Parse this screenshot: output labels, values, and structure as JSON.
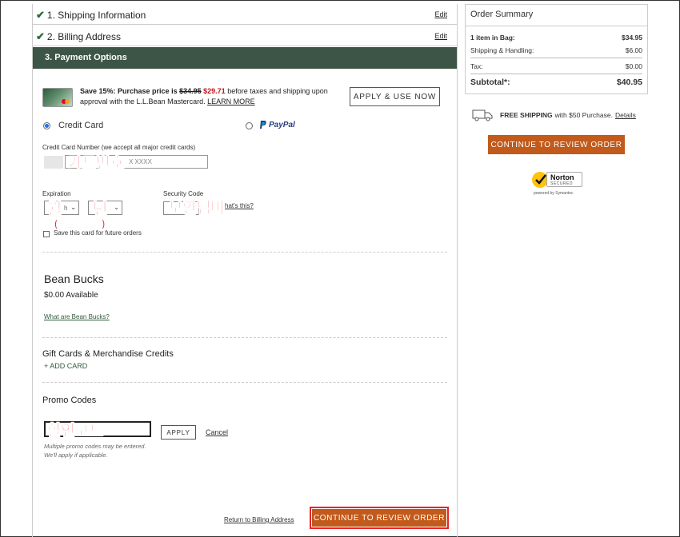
{
  "steps": [
    {
      "number_label": "1. Shipping Information",
      "edit": "Edit",
      "complete": true
    },
    {
      "number_label": "2. Billing Address",
      "edit": "Edit",
      "complete": true
    },
    {
      "number_label": "3. Payment Options",
      "active": true
    }
  ],
  "promo": {
    "lead": "Save 15%: Purchase price is",
    "old_price": "$34.95",
    "new_price": "$29.71",
    "tail": "before taxes and shipping upon approval with the L.L.Bean Mastercard.",
    "learn_more": "LEARN MORE",
    "apply_button": "APPLY & USE NOW"
  },
  "payment": {
    "credit_card_label": "Credit Card",
    "paypal_label": "PayPal",
    "card_number_label": "Credit Card Number (we accept all major credit cards)",
    "card_number_placeholder": "X XXXX",
    "expiration_label": "Expiration",
    "month_value": "h",
    "security_label": "Security Code",
    "whats_this": "hat's this?",
    "save_card_label": "Save this card for future orders"
  },
  "annotations": {
    "card_number": "카드번호",
    "month": "월",
    "year": "년",
    "card_expiry": "(카드만료일)",
    "security": "보안넘버",
    "promo_code": "할인코드"
  },
  "bean_bucks": {
    "title": "Bean Bucks",
    "available": "$0.00 Available",
    "link": "What are Bean Bucks?"
  },
  "gift_cards": {
    "title": "Gift Cards & Merchandise Credits",
    "add_card": "+ ADD CARD"
  },
  "promo_codes": {
    "title": "Promo Codes",
    "apply": "APPLY",
    "cancel": "Cancel",
    "note": "Multiple promo codes may be entered. We'll apply if applicable."
  },
  "footer": {
    "return_link": "Return to Billing Address",
    "continue": "CONTINUE TO REVIEW ORDER"
  },
  "summary": {
    "title": "Order Summary",
    "rows": [
      {
        "label": "1 item in Bag:",
        "value": "$34.95"
      },
      {
        "label": "Shipping & Handling:",
        "value": "$6.00"
      },
      {
        "label": "Tax:",
        "value": "$0.00"
      },
      {
        "label": "Subtotal*:",
        "value": "$40.95"
      }
    ],
    "free_shipping_bold": "FREE SHIPPING",
    "free_shipping_rest": "with $50 Purchase.",
    "details": "Details",
    "continue": "CONTINUE TO REVIEW ORDER",
    "norton_brand": "Norton",
    "norton_secured": "SECURED",
    "norton_powered": "powered by Symantec"
  },
  "colors": {
    "header_green": "#3d5546",
    "cta_orange": "#c15a1a",
    "annotation_red": "#e8232a"
  },
  "icons": [
    "checkmark-icon",
    "truck-icon",
    "paypal-icon",
    "norton-icon",
    "mastercard-icon"
  ]
}
